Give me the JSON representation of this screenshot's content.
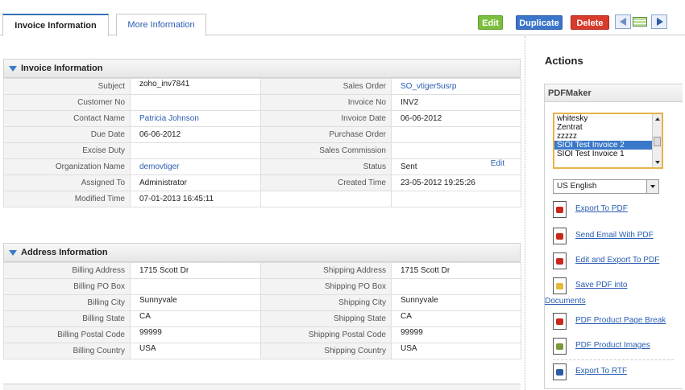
{
  "tabs": {
    "active": "Invoice Information",
    "more": "More Information"
  },
  "toolbar": {
    "edit": "Edit",
    "duplicate": "Duplicate",
    "delete": "Delete"
  },
  "invoice_section": {
    "title": "Invoice Information",
    "rows": [
      {
        "l1": "Subject",
        "v1": "zoho_inv7841",
        "l2": "Sales Order",
        "v2": "SO_vtiger5usrp"
      },
      {
        "l1": "Customer No",
        "v1": "",
        "l2": "Invoice No",
        "v2": "INV2"
      },
      {
        "l1": "Contact Name",
        "v1": "Patricia Johnson",
        "l2": "Invoice Date",
        "v2": "06-06-2012"
      },
      {
        "l1": "Due Date",
        "v1": "06-06-2012",
        "l2": "Purchase Order",
        "v2": ""
      },
      {
        "l1": "Excise Duty",
        "v1": "",
        "l2": "Sales Commission",
        "v2": ""
      },
      {
        "l1": "Organization Name",
        "v1": "demovtiger",
        "l2": "Status",
        "v2": "Sent",
        "edit": "Edit"
      },
      {
        "l1": "Assigned To",
        "v1": "Administrator",
        "l2": "Created Time",
        "v2": "23-05-2012 19:25:26"
      },
      {
        "l1": "Modified Time",
        "v1": "07-01-2013 16:45:11"
      }
    ]
  },
  "address_section": {
    "title": "Address Information",
    "rows": [
      {
        "l1": "Billing Address",
        "v1": "1715 Scott Dr",
        "l2": "Shipping Address",
        "v2": "1715 Scott Dr"
      },
      {
        "l1": "Billing PO Box",
        "v1": "",
        "l2": "Shipping PO Box",
        "v2": ""
      },
      {
        "l1": "Billing City",
        "v1": "Sunnyvale",
        "l2": "Shipping City",
        "v2": "Sunnyvale"
      },
      {
        "l1": "Billing State",
        "v1": "CA",
        "l2": "Shipping State",
        "v2": "CA"
      },
      {
        "l1": "Billing Postal Code",
        "v1": "99999",
        "l2": "Shipping Postal Code",
        "v2": "99999"
      },
      {
        "l1": "Billing Country",
        "v1": "USA",
        "l2": "Shipping Country",
        "v2": "USA"
      }
    ]
  },
  "sidebar": {
    "title": "Actions",
    "pdfmaker": "PDFMaker",
    "templates": [
      "whitesky",
      "Zentrat",
      "zzzzz",
      "SIOI Test Invoice 2",
      "SIOI Test Invoice 1"
    ],
    "selected_template": "SIOI Test Invoice 2",
    "language": "US English",
    "actions": {
      "export_pdf": "Export To PDF",
      "send_email": "Send Email With PDF",
      "edit_export": "Edit and Export To PDF",
      "save_pdf_line1": "Save PDF into",
      "save_pdf_line2": "Documents",
      "product_break": "PDF Product Page Break",
      "product_images": "PDF Product Images",
      "export_rtf": "Export To RTF"
    }
  },
  "colors": {
    "edit_button": "#7cbf3e",
    "duplicate_button": "#3b75c9",
    "delete_button": "#d83a2b",
    "link": "#2a5db0",
    "selection": "#3a78c9"
  }
}
